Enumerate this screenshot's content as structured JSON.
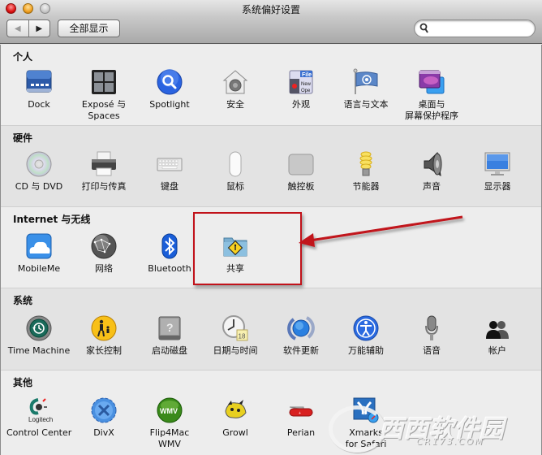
{
  "window": {
    "title": "系统偏好设置",
    "nav": {
      "back_icon": "back-arrow-icon",
      "forward_icon": "forward-arrow-icon",
      "back_glyph": "◀",
      "forward_glyph": "▶"
    },
    "show_all_label": "全部显示",
    "search": {
      "placeholder": "",
      "value": "",
      "icon": "search-icon"
    }
  },
  "sections": [
    {
      "title": "个人",
      "items": [
        {
          "label": "Dock",
          "icon": "dock-icon"
        },
        {
          "label": "Exposé 与",
          "label2": "Spaces",
          "icon": "expose-spaces-icon"
        },
        {
          "label": "Spotlight",
          "icon": "spotlight-icon"
        },
        {
          "label": "安全",
          "icon": "security-icon"
        },
        {
          "label": "外观",
          "icon": "appearance-icon"
        },
        {
          "label": "语言与文本",
          "icon": "language-text-icon"
        },
        {
          "label": "桌面与",
          "label2": "屏幕保护程序",
          "icon": "desktop-screensaver-icon"
        }
      ]
    },
    {
      "title": "硬件",
      "items": [
        {
          "label": "CD 与 DVD",
          "icon": "cd-dvd-icon"
        },
        {
          "label": "打印与传真",
          "icon": "print-fax-icon"
        },
        {
          "label": "键盘",
          "icon": "keyboard-icon"
        },
        {
          "label": "鼠标",
          "icon": "mouse-icon"
        },
        {
          "label": "触控板",
          "icon": "trackpad-icon"
        },
        {
          "label": "节能器",
          "icon": "energy-saver-icon"
        },
        {
          "label": "声音",
          "icon": "sound-icon"
        },
        {
          "label": "显示器",
          "icon": "displays-icon"
        }
      ]
    },
    {
      "title": "Internet 与无线",
      "items": [
        {
          "label": "MobileMe",
          "icon": "mobileme-icon"
        },
        {
          "label": "网络",
          "icon": "network-icon"
        },
        {
          "label": "Bluetooth",
          "icon": "bluetooth-icon"
        },
        {
          "label": "共享",
          "icon": "sharing-icon"
        }
      ]
    },
    {
      "title": "系统",
      "items": [
        {
          "label": "Time Machine",
          "icon": "time-machine-icon"
        },
        {
          "label": "家长控制",
          "icon": "parental-controls-icon"
        },
        {
          "label": "启动磁盘",
          "icon": "startup-disk-icon"
        },
        {
          "label": "日期与时间",
          "icon": "date-time-icon",
          "badge": "18"
        },
        {
          "label": "软件更新",
          "icon": "software-update-icon"
        },
        {
          "label": "万能辅助",
          "icon": "universal-access-icon"
        },
        {
          "label": "语音",
          "icon": "speech-icon"
        },
        {
          "label": "帐户",
          "icon": "accounts-icon"
        }
      ]
    },
    {
      "title": "其他",
      "items": [
        {
          "label": "Control Center",
          "icon": "logitech-icon",
          "brand": "Logitech"
        },
        {
          "label": "DivX",
          "icon": "divx-icon"
        },
        {
          "label": "Flip4Mac",
          "label2": "WMV",
          "icon": "flip4mac-icon",
          "badge": "WMV"
        },
        {
          "label": "Growl",
          "icon": "growl-icon"
        },
        {
          "label": "Perian",
          "icon": "perian-icon"
        },
        {
          "label": "Xmarks",
          "label2": "for Safari",
          "icon": "xmarks-icon"
        }
      ]
    }
  ],
  "annotation": {
    "highlight_color": "#c1121a",
    "target": "共享"
  },
  "watermark": {
    "cn": "西西软件园",
    "en": "CR173.COM"
  }
}
